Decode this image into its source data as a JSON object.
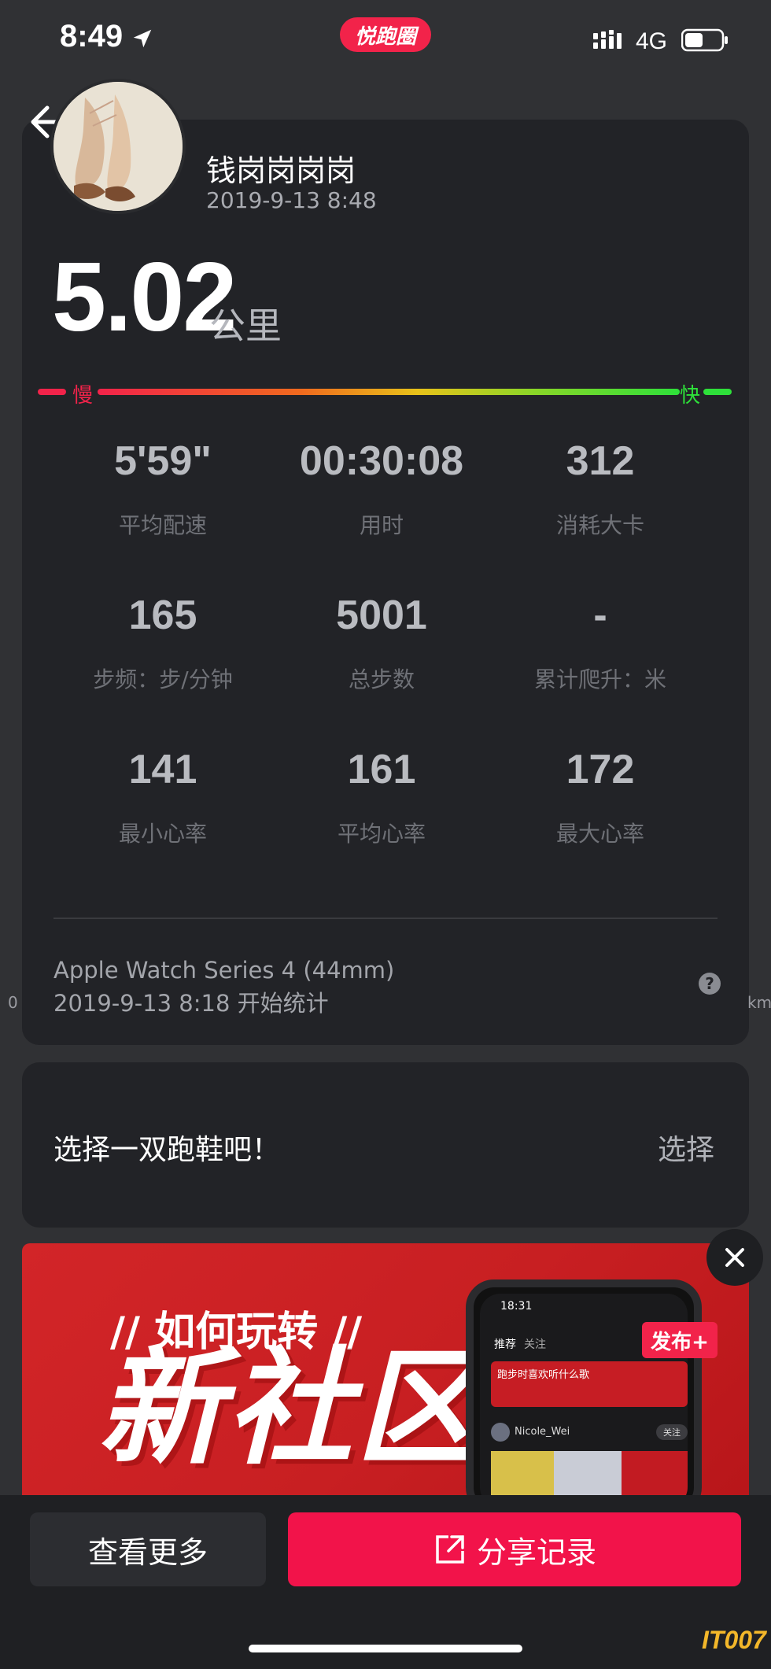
{
  "status": {
    "time": "8:49",
    "brand": "悦跑圈",
    "network": "4G",
    "icons": [
      "location-arrow-icon",
      "signal-bars-icon",
      "battery-icon"
    ]
  },
  "profile": {
    "username": "钱岗岗岗岗",
    "datetime": "2019-9-13 8:48"
  },
  "summary": {
    "distance": "5.02",
    "unit": "公里",
    "slow_label": "慢",
    "fast_label": "快"
  },
  "stats": [
    {
      "value": "5'59\"",
      "label": "平均配速"
    },
    {
      "value": "00:30:08",
      "label": "用时"
    },
    {
      "value": "312",
      "label": "消耗大卡"
    },
    {
      "value": "165",
      "label": "步频：步/分钟"
    },
    {
      "value": "5001",
      "label": "总步数"
    },
    {
      "value": "-",
      "label": "累计爬升：米"
    },
    {
      "value": "141",
      "label": "最小心率"
    },
    {
      "value": "161",
      "label": "平均心率"
    },
    {
      "value": "172",
      "label": "最大心率"
    }
  ],
  "device": {
    "name": "Apple Watch Series 4 (44mm)",
    "start": "2019-9-13 8:18 开始统计",
    "help": "?",
    "edge_left": "0",
    "edge_right": "km"
  },
  "shoe": {
    "prompt": "选择一双跑鞋吧！",
    "action": "选择"
  },
  "banner": {
    "subtitle": "// 如何玩转 //",
    "title": "新社区",
    "phone_time": "18:31",
    "phone_tab_1": "推荐",
    "phone_tab_2": "关注",
    "phone_card_title": "跑步时喜欢听什么歌",
    "phone_user": "Nicole_Wei",
    "phone_follow": "关注",
    "publish": "发布+"
  },
  "actions": {
    "more": "查看更多",
    "share": "分享记录"
  },
  "watermark": "IT007",
  "colors": {
    "accent": "#f2134a",
    "background": "#303134",
    "card": "#222327",
    "slow": "#f2234a",
    "fast": "#2ee03a"
  }
}
